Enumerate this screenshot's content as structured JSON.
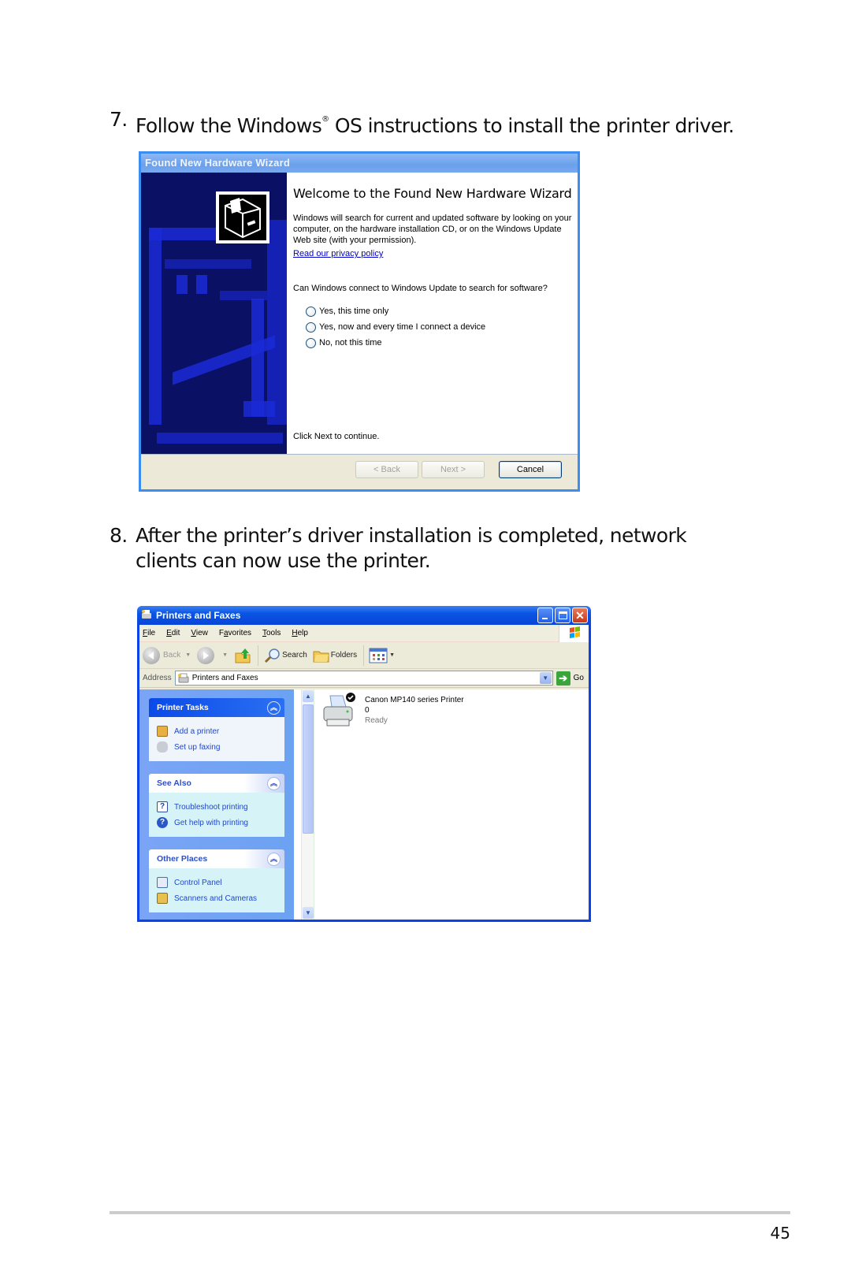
{
  "steps": [
    {
      "number": "7.",
      "text_before": "Follow the Windows",
      "superscript": "®",
      "text_after": " OS instructions to install the printer driver."
    },
    {
      "number": "8.",
      "text": "After the printer’s driver installation is completed, network clients can now use the printer."
    }
  ],
  "wizard": {
    "title": "Found New Hardware Wizard",
    "heading": "Welcome to the Found New Hardware Wizard",
    "description": "Windows will search for current and updated software by looking on your computer, on the hardware installation CD, or on the Windows Update Web site (with your permission).",
    "privacy_link": "Read our privacy policy",
    "question": "Can Windows connect to Windows Update to search for software?",
    "options": [
      {
        "label": "Yes, this time only",
        "selected": false
      },
      {
        "label": "Yes, now and every time I connect a device",
        "selected": false
      },
      {
        "label": "No, not this time",
        "selected": false
      }
    ],
    "continue_text": "Click Next to continue.",
    "buttons": {
      "back": "< Back",
      "next": "Next >",
      "cancel": "Cancel"
    },
    "colors": {
      "banner": "#0a1064",
      "accent": "#1a2ad6",
      "frame": "#3b8ef0"
    }
  },
  "printers_window": {
    "title": "Printers and Faxes",
    "menu": [
      "File",
      "Edit",
      "View",
      "Favorites",
      "Tools",
      "Help"
    ],
    "menu_accel": [
      "F",
      "E",
      "V",
      "a",
      "T",
      "H"
    ],
    "toolbar": {
      "back": "Back",
      "search": "Search",
      "folders": "Folders"
    },
    "address": {
      "label": "Address",
      "value": "Printers and Faxes",
      "go": "Go"
    },
    "task_panels": [
      {
        "title": "Printer Tasks",
        "links": [
          {
            "label": "Add a printer",
            "icon": "add-printer-icon"
          },
          {
            "label": "Set up faxing",
            "icon": "fax-icon"
          }
        ]
      },
      {
        "title": "See Also",
        "links": [
          {
            "label": "Troubleshoot printing",
            "icon": "troubleshoot-icon"
          },
          {
            "label": "Get help with printing",
            "icon": "help-icon"
          }
        ]
      },
      {
        "title": "Other Places",
        "links": [
          {
            "label": "Control Panel",
            "icon": "control-panel-icon"
          },
          {
            "label": "Scanners and Cameras",
            "icon": "scanner-icon"
          }
        ]
      }
    ],
    "printer": {
      "name": "Canon MP140 series Printer",
      "documents": "0",
      "status": "Ready",
      "default": true
    },
    "colors": {
      "titlebar": "#0a54e4",
      "taskpane": "#6ca2f2",
      "link": "#2148c8"
    }
  },
  "page_number": "45"
}
